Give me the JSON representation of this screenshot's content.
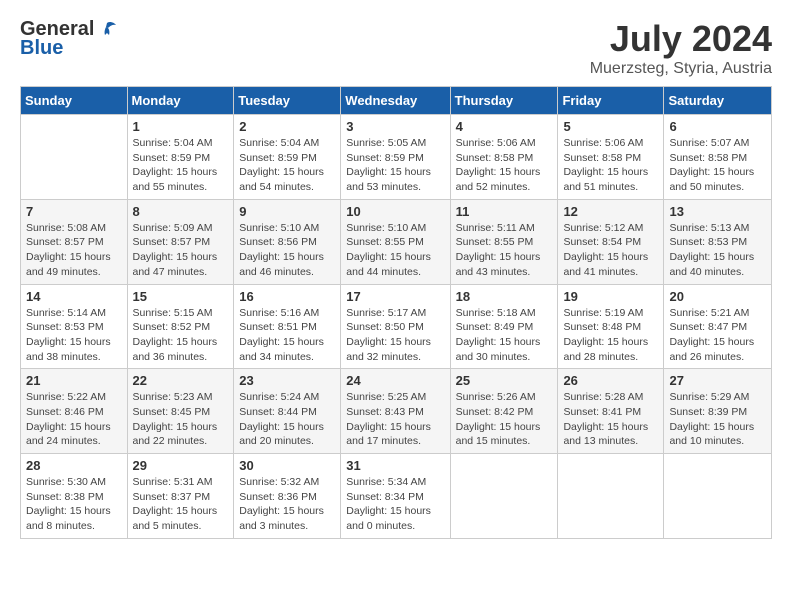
{
  "header": {
    "logo_general": "General",
    "logo_blue": "Blue",
    "month_title": "July 2024",
    "location": "Muerzsteg, Styria, Austria"
  },
  "weekdays": [
    "Sunday",
    "Monday",
    "Tuesday",
    "Wednesday",
    "Thursday",
    "Friday",
    "Saturday"
  ],
  "weeks": [
    [
      {
        "day": "",
        "info": ""
      },
      {
        "day": "1",
        "info": "Sunrise: 5:04 AM\nSunset: 8:59 PM\nDaylight: 15 hours\nand 55 minutes."
      },
      {
        "day": "2",
        "info": "Sunrise: 5:04 AM\nSunset: 8:59 PM\nDaylight: 15 hours\nand 54 minutes."
      },
      {
        "day": "3",
        "info": "Sunrise: 5:05 AM\nSunset: 8:59 PM\nDaylight: 15 hours\nand 53 minutes."
      },
      {
        "day": "4",
        "info": "Sunrise: 5:06 AM\nSunset: 8:58 PM\nDaylight: 15 hours\nand 52 minutes."
      },
      {
        "day": "5",
        "info": "Sunrise: 5:06 AM\nSunset: 8:58 PM\nDaylight: 15 hours\nand 51 minutes."
      },
      {
        "day": "6",
        "info": "Sunrise: 5:07 AM\nSunset: 8:58 PM\nDaylight: 15 hours\nand 50 minutes."
      }
    ],
    [
      {
        "day": "7",
        "info": "Sunrise: 5:08 AM\nSunset: 8:57 PM\nDaylight: 15 hours\nand 49 minutes."
      },
      {
        "day": "8",
        "info": "Sunrise: 5:09 AM\nSunset: 8:57 PM\nDaylight: 15 hours\nand 47 minutes."
      },
      {
        "day": "9",
        "info": "Sunrise: 5:10 AM\nSunset: 8:56 PM\nDaylight: 15 hours\nand 46 minutes."
      },
      {
        "day": "10",
        "info": "Sunrise: 5:10 AM\nSunset: 8:55 PM\nDaylight: 15 hours\nand 44 minutes."
      },
      {
        "day": "11",
        "info": "Sunrise: 5:11 AM\nSunset: 8:55 PM\nDaylight: 15 hours\nand 43 minutes."
      },
      {
        "day": "12",
        "info": "Sunrise: 5:12 AM\nSunset: 8:54 PM\nDaylight: 15 hours\nand 41 minutes."
      },
      {
        "day": "13",
        "info": "Sunrise: 5:13 AM\nSunset: 8:53 PM\nDaylight: 15 hours\nand 40 minutes."
      }
    ],
    [
      {
        "day": "14",
        "info": "Sunrise: 5:14 AM\nSunset: 8:53 PM\nDaylight: 15 hours\nand 38 minutes."
      },
      {
        "day": "15",
        "info": "Sunrise: 5:15 AM\nSunset: 8:52 PM\nDaylight: 15 hours\nand 36 minutes."
      },
      {
        "day": "16",
        "info": "Sunrise: 5:16 AM\nSunset: 8:51 PM\nDaylight: 15 hours\nand 34 minutes."
      },
      {
        "day": "17",
        "info": "Sunrise: 5:17 AM\nSunset: 8:50 PM\nDaylight: 15 hours\nand 32 minutes."
      },
      {
        "day": "18",
        "info": "Sunrise: 5:18 AM\nSunset: 8:49 PM\nDaylight: 15 hours\nand 30 minutes."
      },
      {
        "day": "19",
        "info": "Sunrise: 5:19 AM\nSunset: 8:48 PM\nDaylight: 15 hours\nand 28 minutes."
      },
      {
        "day": "20",
        "info": "Sunrise: 5:21 AM\nSunset: 8:47 PM\nDaylight: 15 hours\nand 26 minutes."
      }
    ],
    [
      {
        "day": "21",
        "info": "Sunrise: 5:22 AM\nSunset: 8:46 PM\nDaylight: 15 hours\nand 24 minutes."
      },
      {
        "day": "22",
        "info": "Sunrise: 5:23 AM\nSunset: 8:45 PM\nDaylight: 15 hours\nand 22 minutes."
      },
      {
        "day": "23",
        "info": "Sunrise: 5:24 AM\nSunset: 8:44 PM\nDaylight: 15 hours\nand 20 minutes."
      },
      {
        "day": "24",
        "info": "Sunrise: 5:25 AM\nSunset: 8:43 PM\nDaylight: 15 hours\nand 17 minutes."
      },
      {
        "day": "25",
        "info": "Sunrise: 5:26 AM\nSunset: 8:42 PM\nDaylight: 15 hours\nand 15 minutes."
      },
      {
        "day": "26",
        "info": "Sunrise: 5:28 AM\nSunset: 8:41 PM\nDaylight: 15 hours\nand 13 minutes."
      },
      {
        "day": "27",
        "info": "Sunrise: 5:29 AM\nSunset: 8:39 PM\nDaylight: 15 hours\nand 10 minutes."
      }
    ],
    [
      {
        "day": "28",
        "info": "Sunrise: 5:30 AM\nSunset: 8:38 PM\nDaylight: 15 hours\nand 8 minutes."
      },
      {
        "day": "29",
        "info": "Sunrise: 5:31 AM\nSunset: 8:37 PM\nDaylight: 15 hours\nand 5 minutes."
      },
      {
        "day": "30",
        "info": "Sunrise: 5:32 AM\nSunset: 8:36 PM\nDaylight: 15 hours\nand 3 minutes."
      },
      {
        "day": "31",
        "info": "Sunrise: 5:34 AM\nSunset: 8:34 PM\nDaylight: 15 hours\nand 0 minutes."
      },
      {
        "day": "",
        "info": ""
      },
      {
        "day": "",
        "info": ""
      },
      {
        "day": "",
        "info": ""
      }
    ]
  ]
}
